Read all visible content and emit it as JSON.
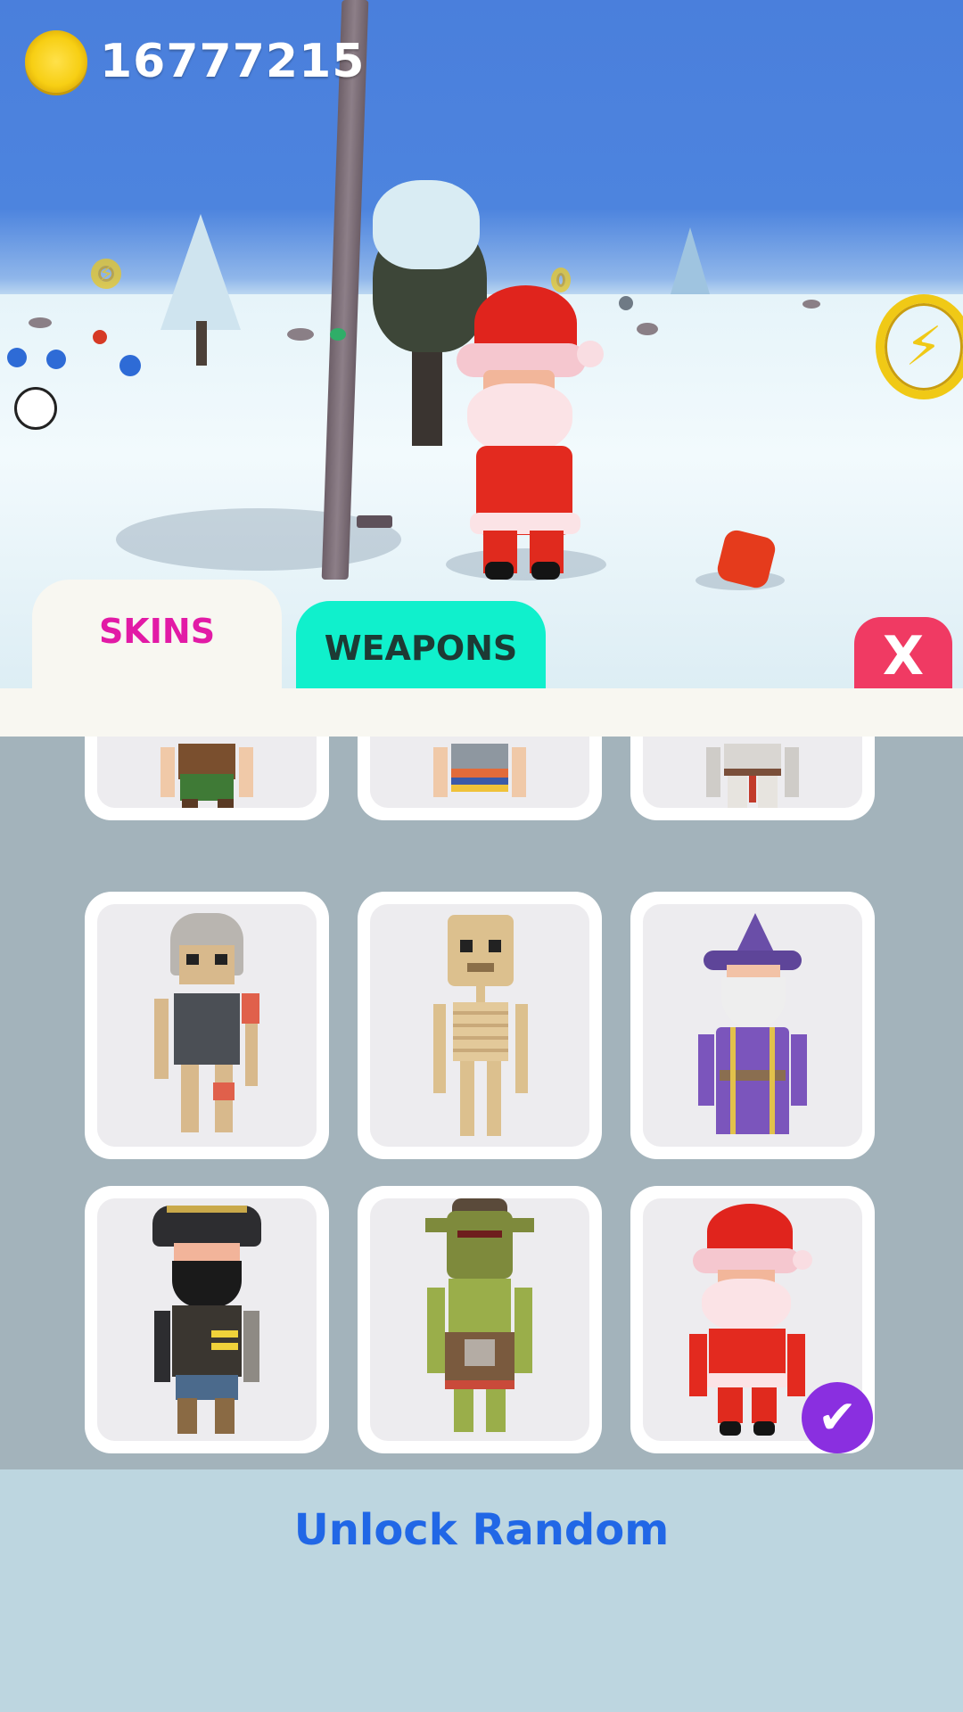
{
  "hud": {
    "coins": "16777215",
    "coin_icon": "coin-icon"
  },
  "tabs": {
    "skins_label": "SKINS",
    "weapons_label": "WEAPONS",
    "close_label": "X",
    "active": "skins"
  },
  "skins": [
    {
      "name": "partial-skin-1",
      "icon": "villager-icon"
    },
    {
      "name": "partial-skin-2",
      "icon": "striped-character-icon"
    },
    {
      "name": "partial-skin-3",
      "icon": "knight-icon"
    },
    {
      "name": "armored-skeleton",
      "icon": "armored-skeleton-icon"
    },
    {
      "name": "skeleton",
      "icon": "skeleton-icon"
    },
    {
      "name": "wizard",
      "icon": "wizard-icon"
    },
    {
      "name": "pirate",
      "icon": "pirate-icon"
    },
    {
      "name": "orc",
      "icon": "orc-icon"
    },
    {
      "name": "santa",
      "icon": "santa-icon",
      "selected": true
    }
  ],
  "actions": {
    "unlock_random_label": "Unlock Random"
  },
  "colors": {
    "skins_tab_text": "#e21aa6",
    "weapons_tab_bg": "#10f0cc",
    "close_bg": "#f03a63",
    "unlock_text": "#2167e6",
    "selected_check": "#8a2fe0"
  }
}
